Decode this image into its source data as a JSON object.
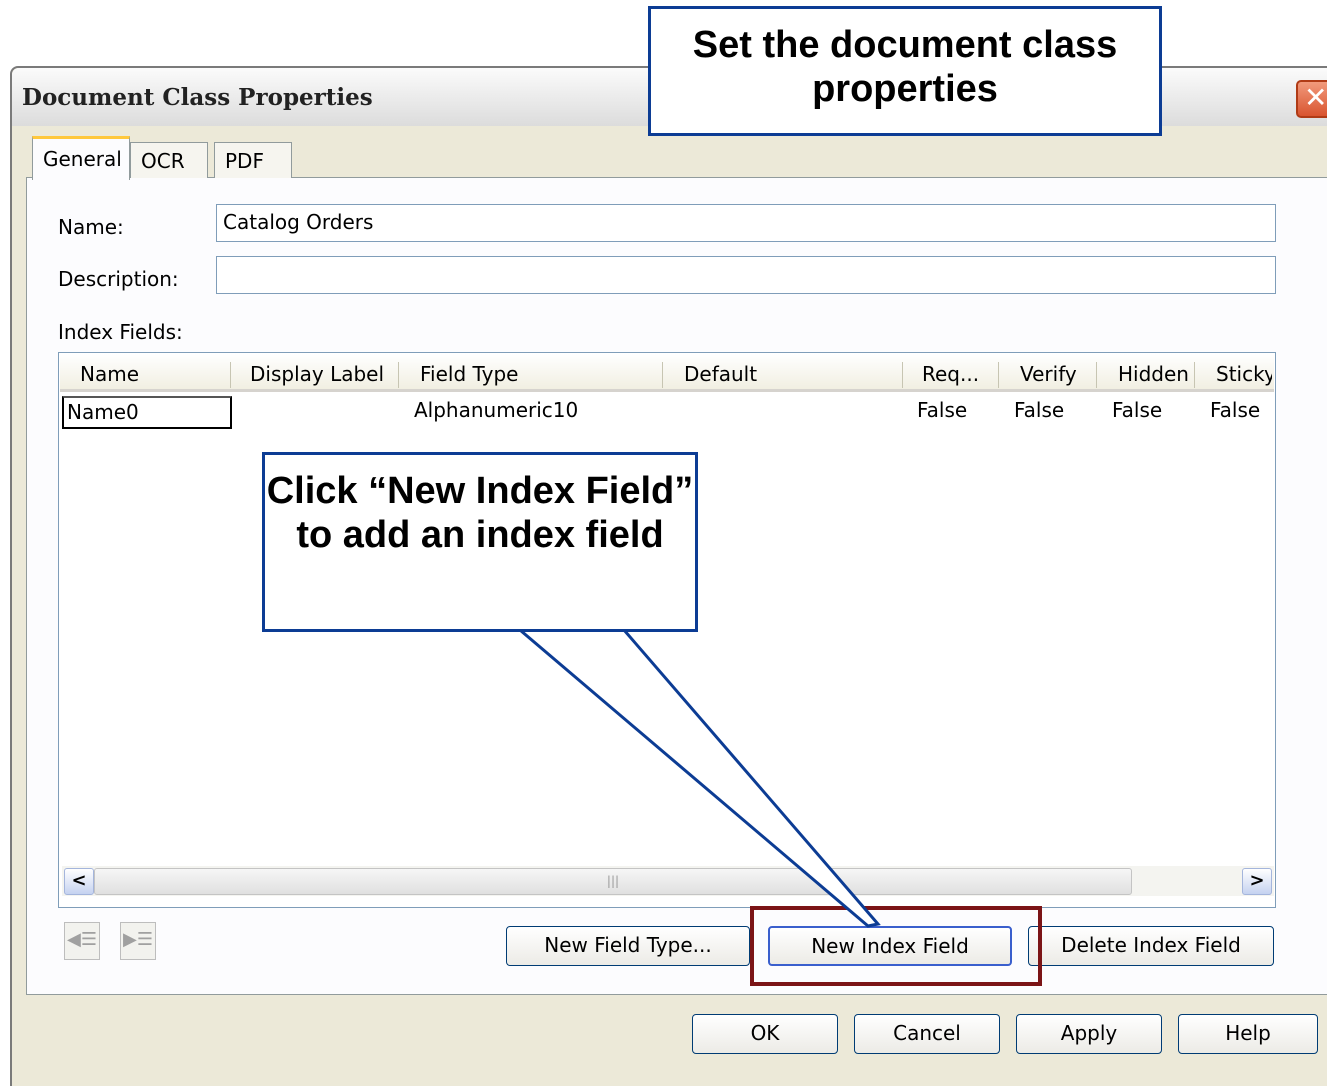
{
  "window": {
    "title": "Document Class Properties",
    "close_glyph": "✕"
  },
  "tabs": [
    {
      "label": "General",
      "active": true
    },
    {
      "label": "OCR",
      "active": false
    },
    {
      "label": "PDF",
      "active": false
    }
  ],
  "form": {
    "name_label": "Name:",
    "name_value": "Catalog Orders",
    "description_label": "Description:",
    "description_value": "",
    "index_fields_label": "Index Fields:"
  },
  "index_table": {
    "columns": [
      "Name",
      "Display Label",
      "Field Type",
      "Default",
      "Req...",
      "Verify",
      "Hidden",
      "Sticky"
    ],
    "rows": [
      {
        "name": "Name0",
        "display_label": "",
        "field_type": "Alphanumeric10",
        "default": "",
        "required": "False",
        "verify": "False",
        "hidden": "False",
        "sticky": "False"
      }
    ],
    "scroll_left": "<",
    "scroll_right": ">",
    "scroll_grip": "|||"
  },
  "move_icons": {
    "left": "move-left-icon",
    "right": "move-right-icon"
  },
  "buttons": {
    "new_field_type": "New Field Type...",
    "new_index_field": "New Index Field",
    "delete_index_field": "Delete Index Field",
    "ok": "OK",
    "cancel": "Cancel",
    "apply": "Apply",
    "help": "Help"
  },
  "callouts": {
    "top": "Set the document class properties",
    "middle": "Click “New Index Field” to add an index field"
  },
  "colors": {
    "callout_border": "#0c3c94",
    "highlight_border": "#7b1416",
    "tab_active_accent": "#ffc83c"
  }
}
